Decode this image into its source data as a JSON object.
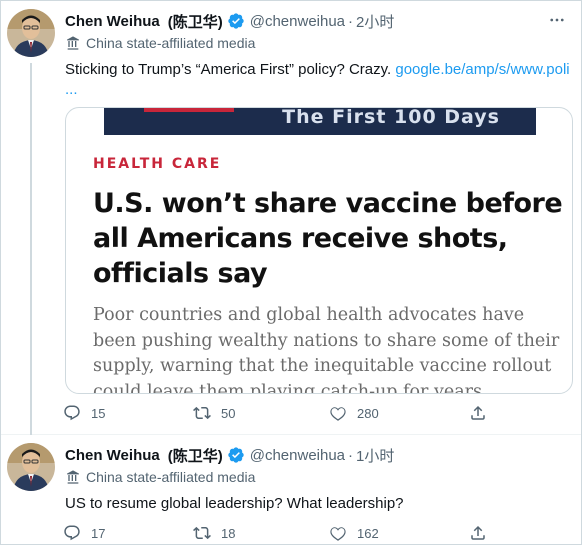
{
  "tweets": [
    {
      "author_name": "Chen Weihua",
      "author_name_cn": "(陈卫华)",
      "handle": "@chenweihua",
      "time": "2小时",
      "affiliation": "China state-affiliated media",
      "text": "Sticking to Trump’s “America First” policy? Crazy. ",
      "link": "google.be/amp/s/www.poli",
      "link_more": "...",
      "card": {
        "banner_text": "The First 100 Days",
        "kicker": "HEALTH CARE",
        "headline": "U.S. won’t share vaccine before all Americans receive shots, officials say",
        "summary": "Poor countries and global health advocates have been pushing wealthy nations to share some of their supply, warning that the inequitable vaccine rollout could leave them playing catch-up for years"
      },
      "replies": "15",
      "retweets": "50",
      "likes": "280"
    },
    {
      "author_name": "Chen Weihua",
      "author_name_cn": "(陈卫华)",
      "handle": "@chenweihua",
      "time": "1小时",
      "affiliation": "China state-affiliated media",
      "text": "US to resume global leadership? What leadership?",
      "replies": "17",
      "retweets": "18",
      "likes": "162"
    }
  ],
  "colors": {
    "accent": "#1d9bf0",
    "muted": "#536471",
    "kicker_red": "#c8263a"
  },
  "icons": [
    "avatar",
    "verified-badge-icon",
    "more-icon",
    "flag-icon",
    "reply-icon",
    "retweet-icon",
    "like-icon",
    "share-icon"
  ]
}
